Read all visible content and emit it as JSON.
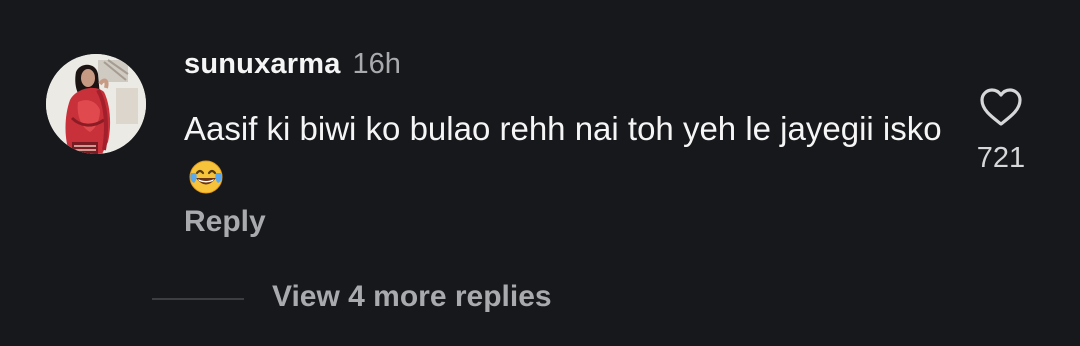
{
  "comment": {
    "username": "sunuxarma",
    "timestamp": "16h",
    "text": "Aasif ki biwi ko bulao rehh nai toh yeh le jayegii isko",
    "emoji": "face-with-tears-of-joy",
    "reply_label": "Reply",
    "like_count": "721",
    "liked": false
  },
  "replies": {
    "view_more_label": "View 4 more replies"
  },
  "colors": {
    "background": "#16181b",
    "primary_text": "#f5f5f5",
    "secondary_text": "#a8aaad",
    "divider": "#3c3e42"
  },
  "icons": {
    "like": "heart-outline-icon"
  }
}
